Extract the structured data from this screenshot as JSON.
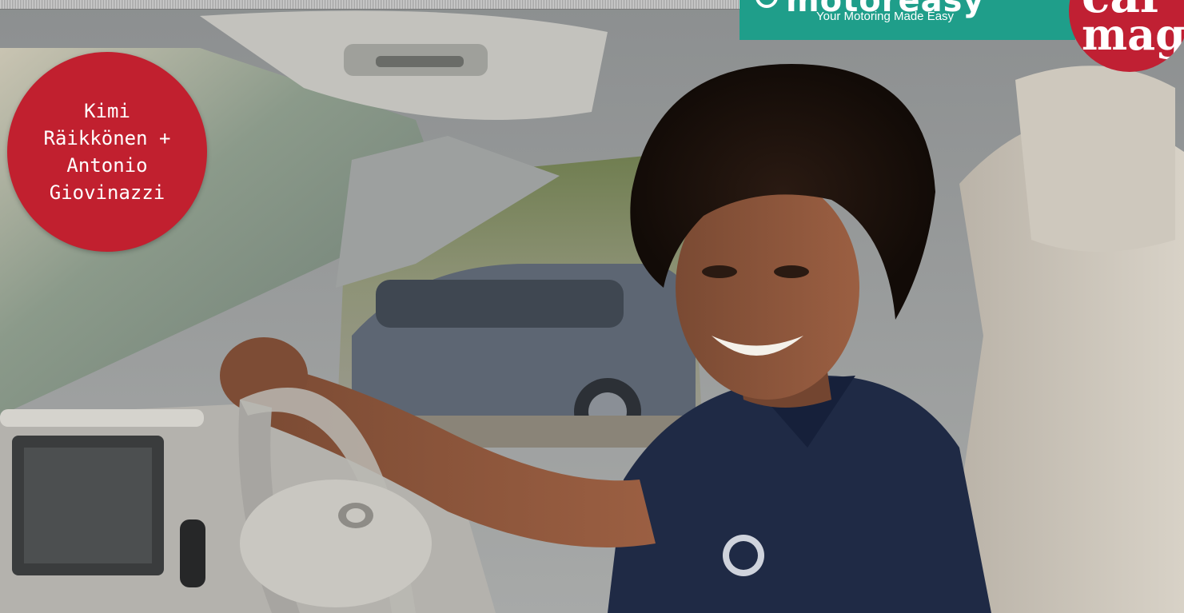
{
  "brand": {
    "name": "motoreasy",
    "tagline": "Your Motoring Made Easy",
    "color": "#1f9e8a"
  },
  "magazine_badge": {
    "line1": "car",
    "line2": "mag",
    "color": "#c02033"
  },
  "feature_badge": {
    "lines": [
      "Kimi",
      "Räikkönen +",
      "Antonio",
      "Giovinazzi"
    ],
    "color": "#c1202f"
  },
  "photo": {
    "subject": "smiling man in navy polo shirt seated at steering wheel of a car",
    "icons": [
      "steering-wheel-icon",
      "car-logo-icon",
      "crest-icon"
    ]
  }
}
